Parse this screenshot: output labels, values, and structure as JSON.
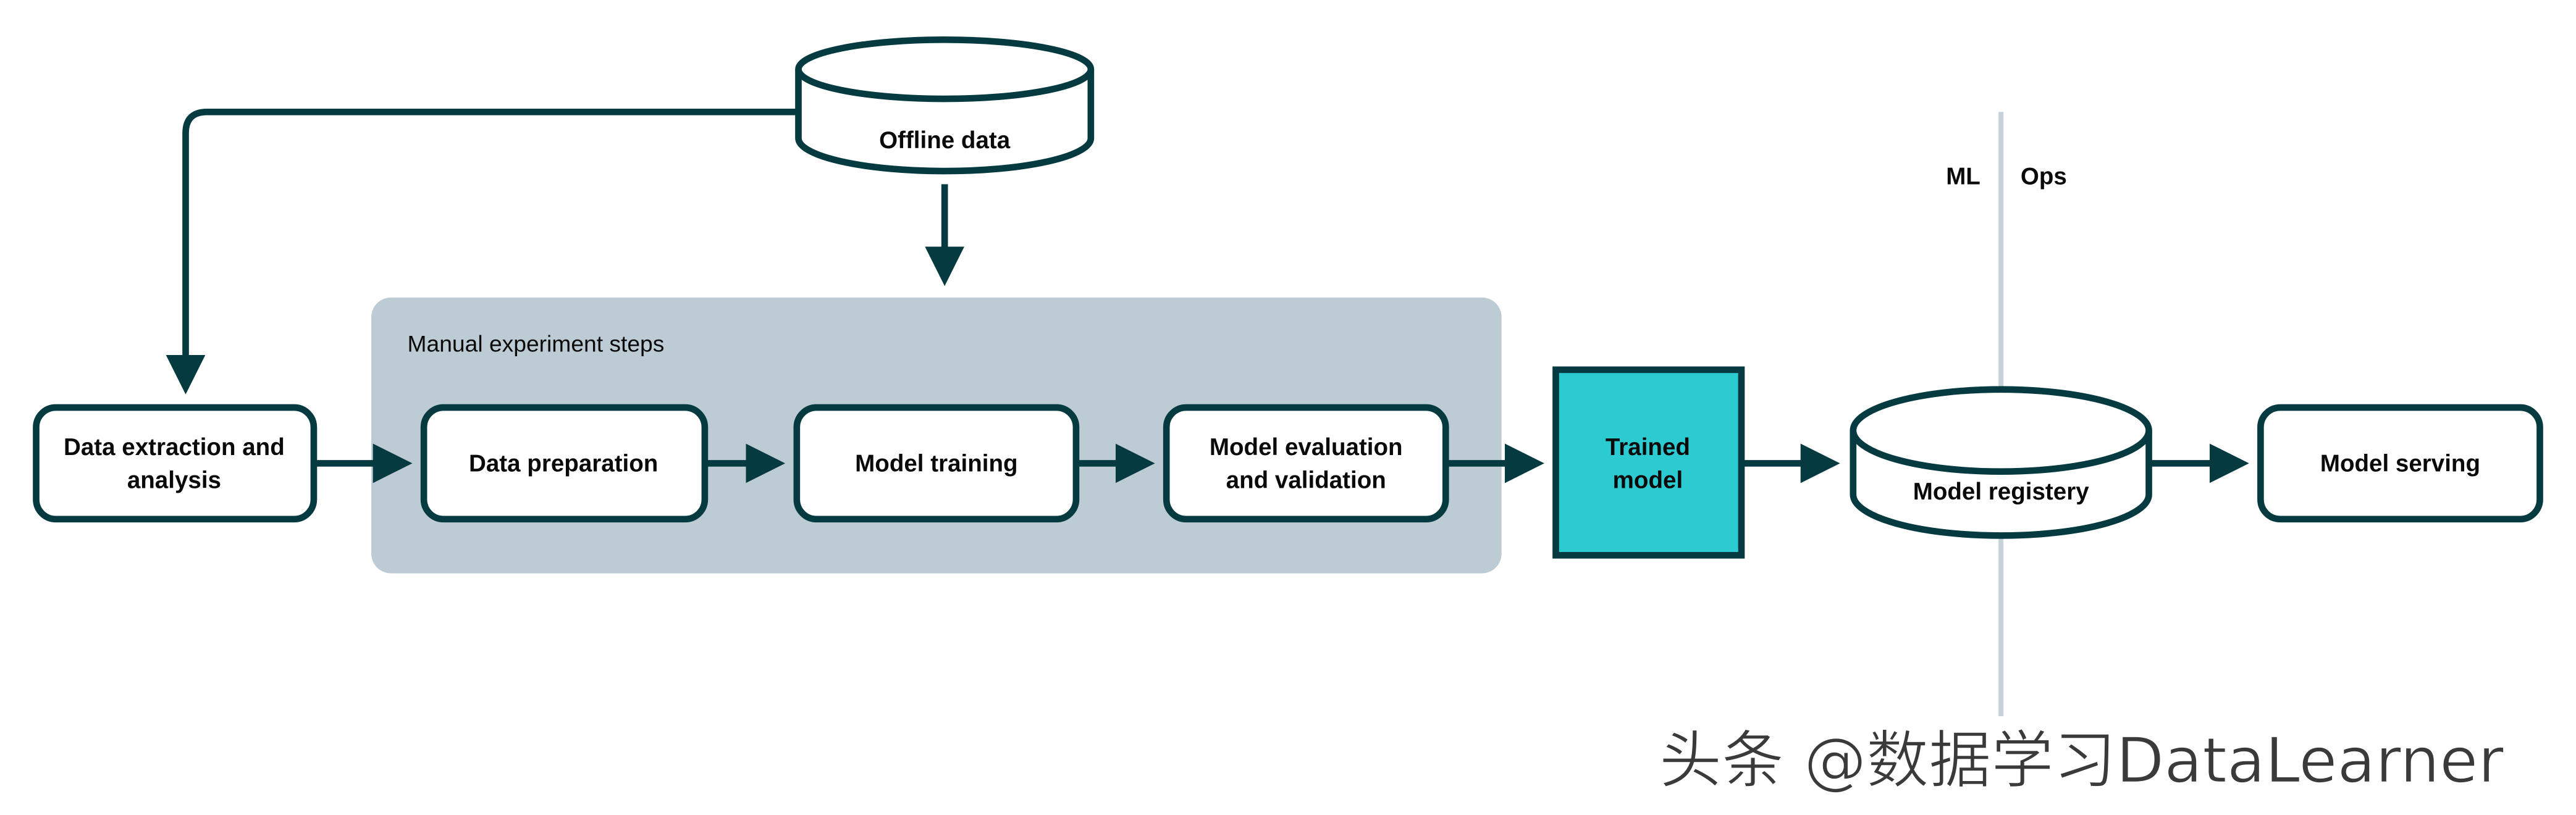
{
  "diagram": {
    "offline_data": "Offline data",
    "panel_title": "Manual experiment steps",
    "data_extraction": [
      "Data extraction and",
      "analysis"
    ],
    "data_preparation": "Data preparation",
    "model_training": "Model training",
    "model_evaluation": [
      "Model evaluation",
      "and validation"
    ],
    "trained_model": [
      "Trained",
      "model"
    ],
    "model_registry": "Model registery",
    "model_serving": "Model serving",
    "divider_left": "ML",
    "divider_right": "Ops",
    "watermark": "头条 @数据学习DataLearner"
  },
  "colors": {
    "stroke": "#053a40",
    "panel": "#bdccd4",
    "trained_model_fill": "#2ccbd2",
    "divider": "#c5d2d9"
  }
}
